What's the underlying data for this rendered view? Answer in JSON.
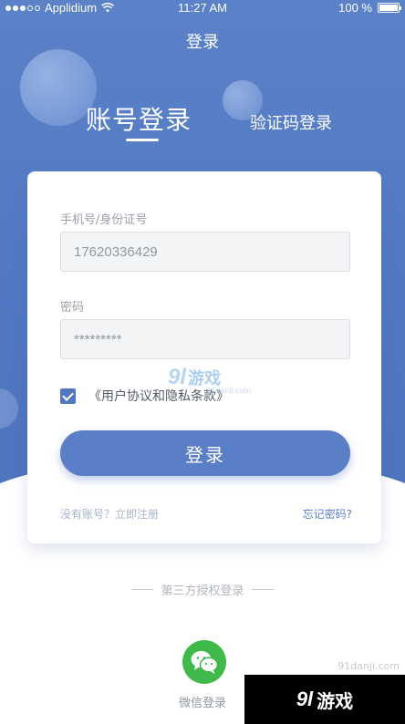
{
  "status_bar": {
    "carrier": "Applidium",
    "time": "11:27 AM",
    "battery": "100 %"
  },
  "nav": {
    "title": "登录"
  },
  "tabs": {
    "account": "账号登录",
    "sms": "验证码登录"
  },
  "form": {
    "phone_label": "手机号/身份证号",
    "phone_value": "17620336429",
    "password_label": "密码",
    "password_value": "*********",
    "agreement": "《用户协议和隐私条款》",
    "agreement_checked": true,
    "login_button": "登录",
    "register_link": "没有账号？立即注册",
    "forgot_link": "忘记密码?"
  },
  "third_party": {
    "title": "第三方授权登录",
    "wechat_label": "微信登录"
  },
  "watermark": {
    "logo": "9l",
    "brand": "游戏",
    "site": "91danji.com"
  },
  "colors": {
    "primary": "#5a7fc6",
    "wechat": "#3fb94a"
  },
  "icons": {
    "wifi": "wifi-icon",
    "battery": "battery-icon",
    "checkbox": "checkbox-checked-icon",
    "wechat": "wechat-icon"
  }
}
